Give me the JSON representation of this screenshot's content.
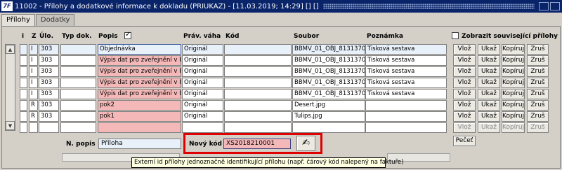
{
  "window": {
    "title": "11002 - Přílohy a dodatkové informace k dokladu (PRIUKAZ) - [11.03.2019; 14:29] [] []"
  },
  "tabs": [
    {
      "label": "Přílohy"
    },
    {
      "label": "Dodatky"
    }
  ],
  "columns": {
    "i": "i",
    "z": "Z",
    "ulo": "Úlo.",
    "typ": "Typ dok.",
    "popis": "Popis",
    "prav": "Práv. váha",
    "kod": "Kód",
    "soubor": "Soubor",
    "poznamka": "Poznámka",
    "show_related": "Zobrazit související přílohy"
  },
  "rows": [
    {
      "i": "",
      "z": "I",
      "ulo": "303",
      "typ": "",
      "popis": "Objednávka",
      "prav": "Originál",
      "kod": "",
      "soubor": "BBMV_01_OBJ_8131370",
      "poznamka": "Tisková sestava"
    },
    {
      "i": "",
      "z": "I",
      "ulo": "303",
      "typ": "",
      "popis": "Výpis dat pro zveřejnění v IS",
      "prav": "Originál",
      "kod": "",
      "soubor": "BBMV_01_OBJ_8131370",
      "poznamka": "Tisková sestava"
    },
    {
      "i": "",
      "z": "I",
      "ulo": "303",
      "typ": "",
      "popis": "Výpis dat pro zveřejnění v IS",
      "prav": "Originál",
      "kod": "",
      "soubor": "BBMV_01_OBJ_8131370",
      "poznamka": "Tisková sestava"
    },
    {
      "i": "",
      "z": "I",
      "ulo": "303",
      "typ": "",
      "popis": "Výpis dat pro zveřejnění v IS",
      "prav": "Originál",
      "kod": "",
      "soubor": "BBMV_01_OBJ_8131370",
      "poznamka": "Tisková sestava"
    },
    {
      "i": "",
      "z": "I",
      "ulo": "303",
      "typ": "",
      "popis": "Výpis dat pro zveřejnění v IS",
      "prav": "Originál",
      "kod": "",
      "soubor": "BBMV_01_OBJ_8131370",
      "poznamka": "Tisková sestava"
    },
    {
      "i": "",
      "z": "R",
      "ulo": "303",
      "typ": "",
      "popis": "pok2",
      "prav": "Originál",
      "kod": "",
      "soubor": "Desert.jpg",
      "poznamka": ""
    },
    {
      "i": "",
      "z": "R",
      "ulo": "303",
      "typ": "",
      "popis": "pok1",
      "prav": "Originál",
      "kod": "",
      "soubor": "Tulips.jpg",
      "poznamka": ""
    },
    {
      "i": "",
      "z": "",
      "ulo": "",
      "typ": "",
      "popis": "",
      "prav": "",
      "kod": "",
      "soubor": "",
      "poznamka": ""
    }
  ],
  "row_buttons": {
    "insert": "Vlož",
    "show": "Ukaž",
    "copy": "Kopíruj",
    "cancel": "Zruš"
  },
  "footer": {
    "n_popis_label": "N. popis",
    "n_popis_value": "Příloha",
    "novy_kod_label": "Nový kód",
    "novy_kod_value": "XS2018210001",
    "pecet_label": "Pečeť",
    "tooltip": "Externí id přílohy jednoznačně identifikující přílohu (např. čárový kód nalepený na faktuře)"
  },
  "icons": {
    "app": "app-logo-icon",
    "scroll_up": "arrow-up-icon",
    "scroll_down": "arrow-down-icon",
    "stamp": "stamp-icon"
  },
  "colors": {
    "titlebar": "#0a246a",
    "pink": "#f4b8b8",
    "highlight_border": "#e00000",
    "tooltip_bg": "#ffffe1"
  }
}
